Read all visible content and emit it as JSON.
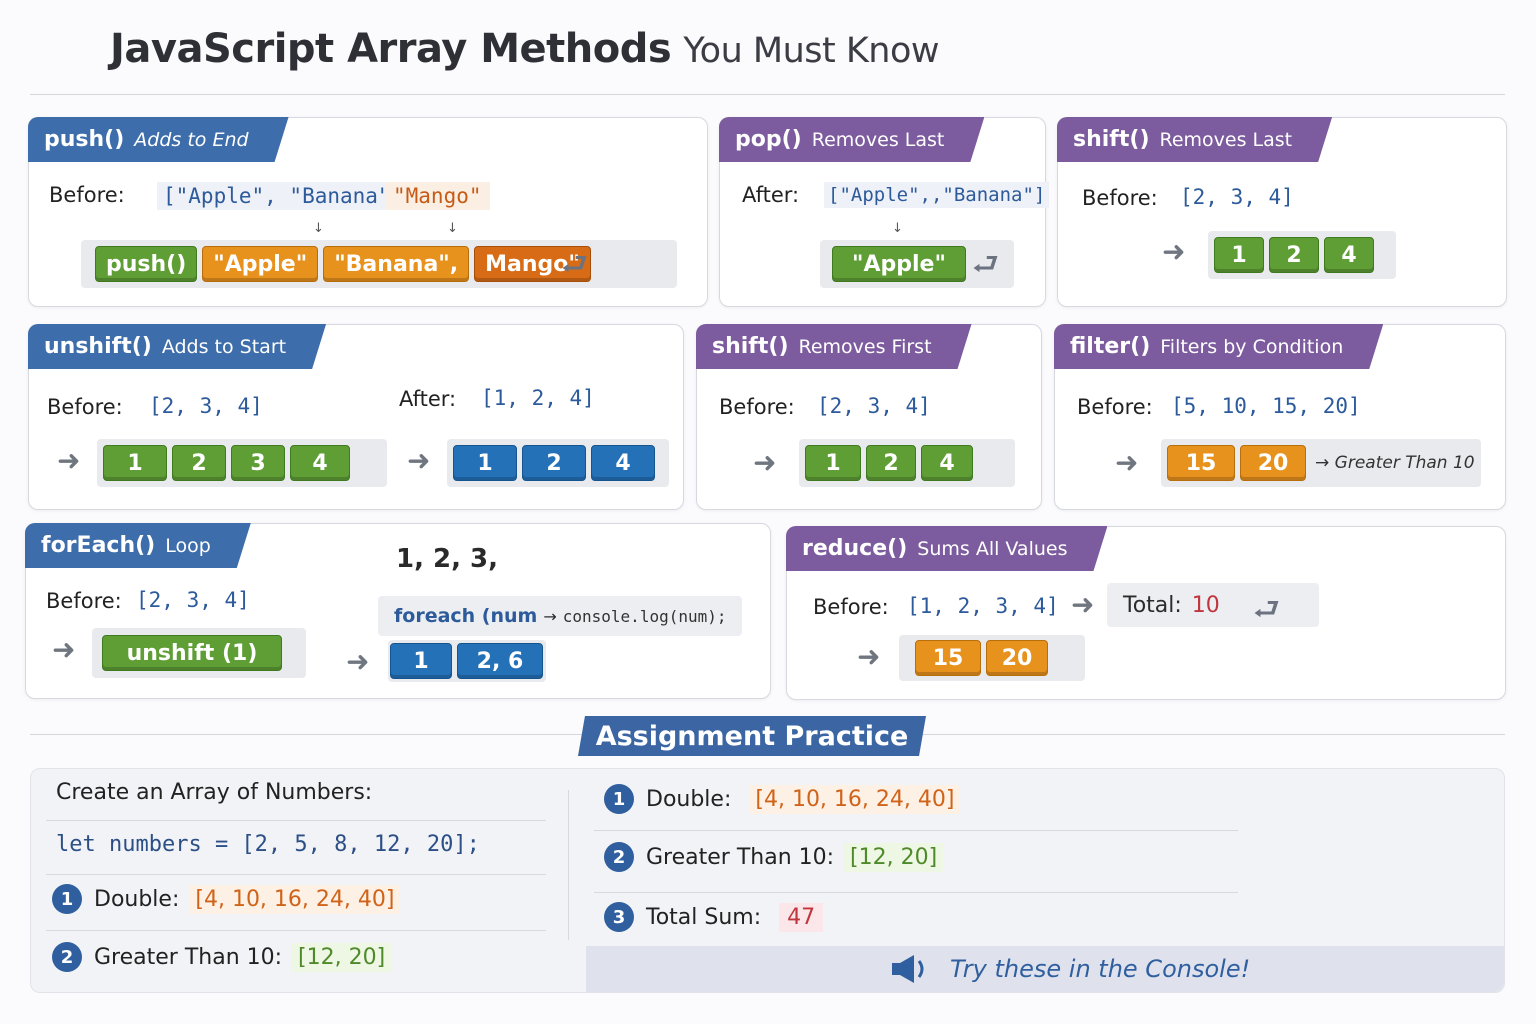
{
  "title": {
    "bold": "JavaScript Array Methods",
    "light": "You Must Know"
  },
  "push": {
    "name": "push()",
    "desc": "Adds to End",
    "before_label": "Before:",
    "before_array": "[\"Apple\",  \"Banana\"],",
    "before_extra": "\"Mango\"",
    "blocks": [
      "push()",
      "\"Apple\"",
      "\"Banana\",",
      "Mango\""
    ]
  },
  "pop": {
    "name": "pop()",
    "desc": "Removes Last",
    "after_label": "After:",
    "after_array": "[\"Apple\",,\"Banana\"]",
    "blocks": [
      "\"Apple\""
    ]
  },
  "shift1": {
    "name": "shift()",
    "desc": "Removes Last",
    "before_label": "Before:",
    "before_array": "[2, 3, 4]",
    "blocks": [
      "1",
      "2",
      "4"
    ]
  },
  "unshift": {
    "name": "unshift()",
    "desc": "Adds to Start",
    "before_label": "Before:",
    "before_array": "[2, 3, 4]",
    "after_label": "After:",
    "after_array": "[1, 2, 4]",
    "blocks_before": [
      "1",
      "2",
      "3",
      "4"
    ],
    "blocks_after": [
      "1",
      "2",
      "4"
    ]
  },
  "shift2": {
    "name": "shift()",
    "desc": "Removes First",
    "before_label": "Before:",
    "before_array": "[2, 3, 4]",
    "blocks": [
      "1",
      "2",
      "4"
    ]
  },
  "filter": {
    "name": "filter()",
    "desc": "Filters by Condition",
    "before_label": "Before:",
    "before_array": "[5, 10, 15, 20]",
    "blocks": [
      "15",
      "20"
    ],
    "note": "Greater Than 10"
  },
  "foreach": {
    "name": "forEach()",
    "desc": "Loop",
    "before_label": "Before:",
    "before_array": "[2, 3, 4]",
    "output": "1,  2,  3,",
    "code_kw": "foreach (num",
    "code_rest": "console.log(num);",
    "block_unshift": "unshift (1)",
    "blocks": [
      "1",
      "2, 6"
    ]
  },
  "reduce": {
    "name": "reduce()",
    "desc": "Sums All Values",
    "before_label": "Before:",
    "before_array": "[1, 2, 3, 4]",
    "total_label": "Total:",
    "total_value": "10",
    "blocks": [
      "15",
      "20"
    ]
  },
  "assignment": {
    "heading": "Assignment Practice",
    "create_label": "Create an Array of Numbers:",
    "code": "let numbers = [2, 5, 8, 12, 20];",
    "left": [
      {
        "n": "1",
        "label": "Double:",
        "value": "[4, 10, 16, 24, 40]"
      },
      {
        "n": "2",
        "label": "Greater Than 10:",
        "value": "[12, 20]"
      }
    ],
    "right": [
      {
        "n": "1",
        "label": "Double:",
        "value": "[4, 10, 16, 24, 40]"
      },
      {
        "n": "2",
        "label": "Greater Than 10:",
        "value": "[12, 20]"
      },
      {
        "n": "3",
        "label": "Total Sum:",
        "value": "47"
      }
    ],
    "console_hint": "Try these in the Console!"
  }
}
